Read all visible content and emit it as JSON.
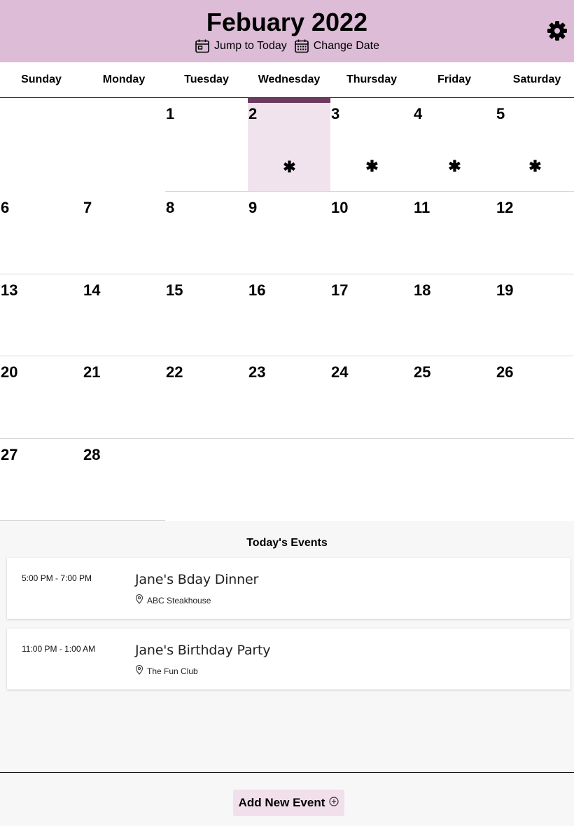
{
  "header": {
    "month_title": "Febuary 2022",
    "jump_today_label": "Jump to Today",
    "change_date_label": "Change Date",
    "settings_icon": "gear-icon"
  },
  "weekdays": [
    "Sunday",
    "Monday",
    "Tuesday",
    "Wednesday",
    "Thursday",
    "Friday",
    "Saturday"
  ],
  "calendar": {
    "today": "2",
    "event_marker": "✱",
    "weeks": [
      [
        {
          "day": ""
        },
        {
          "day": ""
        },
        {
          "day": "1"
        },
        {
          "day": "2",
          "today": true,
          "has_event": true
        },
        {
          "day": "3",
          "has_event": true
        },
        {
          "day": "4",
          "has_event": true
        },
        {
          "day": "5",
          "has_event": true
        }
      ],
      [
        {
          "day": "6"
        },
        {
          "day": "7"
        },
        {
          "day": "8"
        },
        {
          "day": "9"
        },
        {
          "day": "10"
        },
        {
          "day": "11"
        },
        {
          "day": "12"
        }
      ],
      [
        {
          "day": "13"
        },
        {
          "day": "14"
        },
        {
          "day": "15"
        },
        {
          "day": "16"
        },
        {
          "day": "17"
        },
        {
          "day": "18"
        },
        {
          "day": "19"
        }
      ],
      [
        {
          "day": "20"
        },
        {
          "day": "21"
        },
        {
          "day": "22"
        },
        {
          "day": "23"
        },
        {
          "day": "24"
        },
        {
          "day": "25"
        },
        {
          "day": "26"
        }
      ],
      [
        {
          "day": "27"
        },
        {
          "day": "28"
        },
        {
          "day": ""
        },
        {
          "day": ""
        },
        {
          "day": ""
        },
        {
          "day": ""
        },
        {
          "day": ""
        }
      ]
    ]
  },
  "events_panel": {
    "title": "Today's Events",
    "events": [
      {
        "time": "5:00 PM - 7:00 PM",
        "name": "Jane's Bday Dinner",
        "location": "ABC Steakhouse"
      },
      {
        "time": "11:00 PM - 1:00 AM",
        "name": "Jane's Birthday Party",
        "location": "The Fun Club"
      }
    ]
  },
  "footer": {
    "add_event_label": "Add New Event"
  },
  "colors": {
    "header_bg": "#dcbcd6",
    "today_bg": "#f1e3ee",
    "today_accent": "#6b3a60",
    "add_button_bg": "#f1e0ec"
  }
}
